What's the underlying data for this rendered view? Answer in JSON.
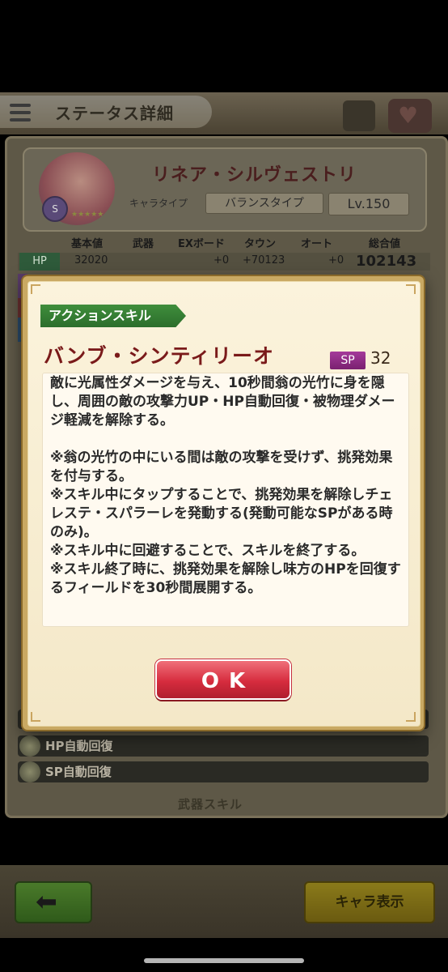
{
  "header": {
    "title": "ステータス詳細"
  },
  "character": {
    "name": "リネア・シルヴェストリ",
    "chara_type_label": "キャラタイプ",
    "chara_type_value": "バランスタイプ",
    "level": "Lv.150",
    "stars": "★★★★★"
  },
  "stats": {
    "columns": [
      "基本値",
      "武器",
      "EXボード",
      "タウン",
      "オート",
      "総合値"
    ],
    "hp": {
      "label": "HP",
      "base": "32020",
      "ex_board": "+0",
      "town": "+70123",
      "auto": "+0",
      "total": "102143"
    }
  },
  "background_skills": [
    {
      "label": "HP自動回復"
    },
    {
      "label": "SP自動回復"
    }
  ],
  "background_footer": "武器スキル",
  "bottom_bar": {
    "chara_button_label": "キャラ表示"
  },
  "dialog": {
    "skill_type": "アクションスキル",
    "skill_name": "バンブ・シンティリーオ",
    "sp_label": "SP",
    "sp_value": "32",
    "description": "敵に光属性ダメージを与え、10秒間翁の光竹に身を隠し、周囲の敵の攻撃力UP・HP自動回復・被物理ダメージ軽減を解除する。\n\n※翁の光竹の中にいる間は敵の攻撃を受けず、挑発効果を付与する。\n※スキル中にタップすることで、挑発効果を解除しチェレステ・スパラーレを発動する(発動可能なSPがある時のみ)。\n※スキル中に回避することで、スキルを終了する。\n※スキル終了時に、挑発効果を解除し味方のHPを回復するフィールドを30秒間展開する。",
    "ok_label": "OK"
  },
  "colors": {
    "dialog_border": "#c9a963",
    "skill_name": "#7a1a1a",
    "tag_green": "#3f8e3c",
    "sp_purple": "#a43a9a",
    "ok_red": "#d62c3e"
  }
}
